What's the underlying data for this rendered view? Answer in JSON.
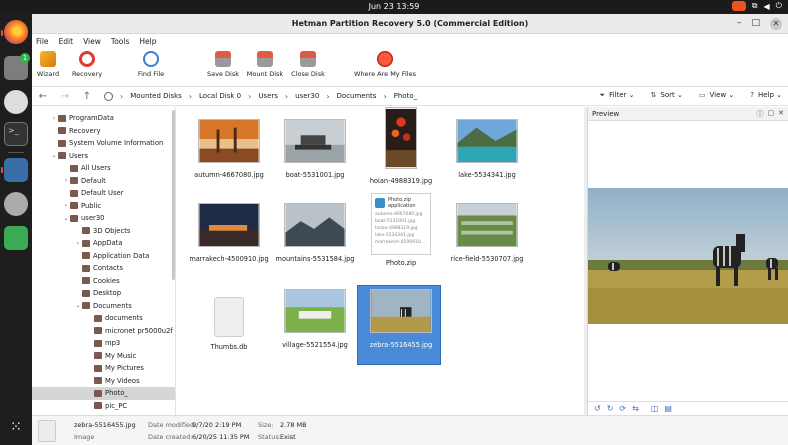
{
  "topbar": {
    "time": "Jun 23  13:59",
    "icons": [
      "screen-record-icon",
      "network-icon",
      "volume-icon",
      "power-icon"
    ]
  },
  "dock": {
    "items": [
      {
        "name": "firefox-icon"
      },
      {
        "name": "files-icon",
        "badge": "1"
      },
      {
        "name": "chat-icon"
      },
      {
        "name": "terminal-icon",
        "glyph": ">_"
      },
      {
        "name": "computer-icon"
      },
      {
        "name": "disk-icon"
      },
      {
        "name": "trash-icon"
      },
      {
        "name": "apps-grid-icon"
      }
    ]
  },
  "window": {
    "title": "Hetman Partition Recovery 5.0 (Commercial Edition)",
    "controls": {
      "minimize": "–",
      "maximize": "□",
      "close": "✕"
    }
  },
  "menu": [
    "File",
    "Edit",
    "View",
    "Tools",
    "Help"
  ],
  "toolbar": [
    {
      "label": "Wizard",
      "icon": "wizard-icon"
    },
    {
      "label": "Recovery",
      "icon": "recovery-icon"
    },
    {
      "label": "Find File",
      "icon": "find-file-icon"
    },
    {
      "label": "Save Disk",
      "icon": "save-disk-icon"
    },
    {
      "label": "Mount Disk",
      "icon": "mount-disk-icon"
    },
    {
      "label": "Close Disk",
      "icon": "close-disk-icon"
    },
    {
      "label": "Where Are My Files",
      "icon": "where-are-my-files-icon"
    }
  ],
  "nav": {
    "breadcrumb": [
      "Mounted Disks",
      "Local Disk 0",
      "Users",
      "user30",
      "Documents",
      "Photo_"
    ],
    "filter": "Filter",
    "sort": "Sort",
    "view": "View",
    "help": "Help"
  },
  "tree": [
    {
      "label": "ProgramData",
      "indent": 1,
      "twisty": "›"
    },
    {
      "label": "Recovery",
      "indent": 1,
      "twisty": ""
    },
    {
      "label": "System Volume Information",
      "indent": 1,
      "twisty": ""
    },
    {
      "label": "Users",
      "indent": 1,
      "twisty": "⌄"
    },
    {
      "label": "All Users",
      "indent": 2,
      "twisty": ""
    },
    {
      "label": "Default",
      "indent": 2,
      "twisty": "›"
    },
    {
      "label": "Default User",
      "indent": 2,
      "twisty": ""
    },
    {
      "label": "Public",
      "indent": 2,
      "twisty": "›"
    },
    {
      "label": "user30",
      "indent": 2,
      "twisty": "⌄"
    },
    {
      "label": "3D Objects",
      "indent": 3,
      "twisty": ""
    },
    {
      "label": "AppData",
      "indent": 3,
      "twisty": "›"
    },
    {
      "label": "Application Data",
      "indent": 3,
      "twisty": ""
    },
    {
      "label": "Contacts",
      "indent": 3,
      "twisty": ""
    },
    {
      "label": "Cookies",
      "indent": 3,
      "twisty": ""
    },
    {
      "label": "Desktop",
      "indent": 3,
      "twisty": ""
    },
    {
      "label": "Documents",
      "indent": 3,
      "twisty": "⌄"
    },
    {
      "label": "documents",
      "indent": 4,
      "twisty": ""
    },
    {
      "label": "micronet pr5000u2f",
      "indent": 4,
      "twisty": ""
    },
    {
      "label": "mp3",
      "indent": 4,
      "twisty": ""
    },
    {
      "label": "My Music",
      "indent": 4,
      "twisty": ""
    },
    {
      "label": "My Pictures",
      "indent": 4,
      "twisty": ""
    },
    {
      "label": "My Videos",
      "indent": 4,
      "twisty": ""
    },
    {
      "label": "Photo_",
      "indent": 4,
      "twisty": "",
      "selected": true
    },
    {
      "label": "pic_PC",
      "indent": 4,
      "twisty": ""
    }
  ],
  "files": [
    {
      "name": "autumn-4667080.jpg",
      "kind": "autumn"
    },
    {
      "name": "boat-5531001.jpg",
      "kind": "boat"
    },
    {
      "name": "hoian-4988319.jpg",
      "kind": "hoian"
    },
    {
      "name": "lake-5534341.jpg",
      "kind": "lake"
    },
    {
      "name": "marrakech-4500910.jpg",
      "kind": "marrakech"
    },
    {
      "name": "mountains-5531584.jpg",
      "kind": "mountains"
    },
    {
      "name": "Photo.zip",
      "kind": "zip"
    },
    {
      "name": "rice-field-5530707.jpg",
      "kind": "rice"
    },
    {
      "name": "Thumbs.db",
      "kind": "db"
    },
    {
      "name": "village-5521554.jpg",
      "kind": "village"
    },
    {
      "name": "zebra-5516455.jpg",
      "kind": "zebra",
      "selected": true
    }
  ],
  "zip_preview": {
    "title": "Photo.zip",
    "subtitle": "application",
    "entries": [
      "autumn-4667080.jpg",
      "boat-5531001.jpg",
      "hoian-4988319.jpg",
      "lake-5534341.jpg",
      "marrakech-4500910..."
    ]
  },
  "preview": {
    "title": "Preview"
  },
  "status": {
    "filename": "zebra-5516455.jpg",
    "type": "Image",
    "modified_label": "Date modified:",
    "modified": "9/7/20 2:19 PM",
    "created_label": "Date created:",
    "created": "6/20/25 11:35 PM",
    "size_label": "Size:",
    "size": "2.78 MB",
    "status_label": "Status:",
    "status": "Exist"
  }
}
